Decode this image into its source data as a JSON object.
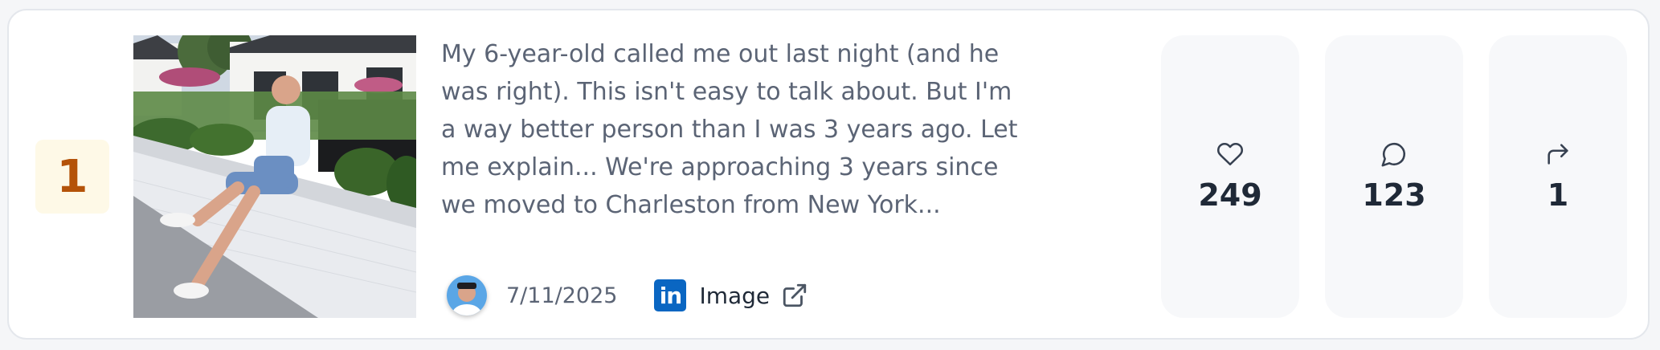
{
  "rank": "1",
  "post": {
    "text": "My 6-year-old called me out last night (and he was right). This isn't easy to talk about. But I'm a way better person than I was 3 years ago. Let me explain... We're approaching 3 years since we moved to Charleston from New York...",
    "date": "7/11/2025",
    "source_label": "Image",
    "source_logo_text": "in"
  },
  "stats": {
    "likes": "249",
    "comments": "123",
    "shares": "1"
  },
  "icons": {
    "likes": "heart-icon",
    "comments": "comment-icon",
    "shares": "share-icon",
    "external": "external-link-icon",
    "network": "linkedin-icon"
  },
  "colors": {
    "rank_bg": "#fef9e7",
    "rank_text": "#b45309",
    "linkedin": "#0a66c2",
    "stat_bg": "#f7f8fa"
  }
}
